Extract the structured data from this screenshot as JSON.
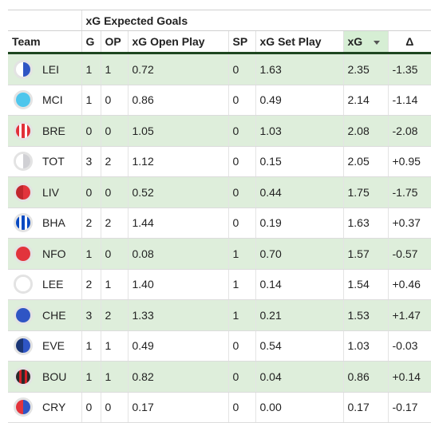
{
  "header": {
    "group_label": "xG Expected Goals",
    "columns": [
      "Team",
      "G",
      "OP",
      "xG Open Play",
      "SP",
      "xG Set Play",
      "xG",
      "Δ"
    ],
    "sorted_column": "xG"
  },
  "rows": [
    {
      "team": "LEI",
      "g": "1",
      "op": "1",
      "xg_op": "0.72",
      "sp": "0",
      "xg_sp": "1.63",
      "xg": "2.35",
      "delta": "-1.35",
      "colors": [
        "#ffffff",
        "#2f55c4"
      ]
    },
    {
      "team": "MCI",
      "g": "1",
      "op": "0",
      "xg_op": "0.86",
      "sp": "0",
      "xg_sp": "0.49",
      "xg": "2.14",
      "delta": "-1.14",
      "colors": [
        "#4ec6ec"
      ]
    },
    {
      "team": "BRE",
      "g": "0",
      "op": "0",
      "xg_op": "1.05",
      "sp": "0",
      "xg_sp": "1.03",
      "xg": "2.08",
      "delta": "-2.08",
      "colors": [
        "#e2303a",
        "#ffffff",
        "#e2303a",
        "#ffffff",
        "#e2303a"
      ]
    },
    {
      "team": "TOT",
      "g": "3",
      "op": "2",
      "xg_op": "1.12",
      "sp": "0",
      "xg_sp": "0.15",
      "xg": "2.05",
      "delta": "+0.95",
      "colors": [
        "#ffffff",
        "#d0d0d4"
      ]
    },
    {
      "team": "LIV",
      "g": "0",
      "op": "0",
      "xg_op": "0.52",
      "sp": "0",
      "xg_sp": "0.44",
      "xg": "1.75",
      "delta": "-1.75",
      "colors": [
        "#c1272d",
        "#e2343c"
      ]
    },
    {
      "team": "BHA",
      "g": "2",
      "op": "2",
      "xg_op": "1.44",
      "sp": "0",
      "xg_sp": "0.19",
      "xg": "1.63",
      "delta": "+0.37",
      "colors": [
        "#0a4ac2",
        "#ffffff",
        "#0a4ac2",
        "#ffffff",
        "#0a4ac2"
      ]
    },
    {
      "team": "NFO",
      "g": "1",
      "op": "0",
      "xg_op": "0.08",
      "sp": "1",
      "xg_sp": "0.70",
      "xg": "1.57",
      "delta": "-0.57",
      "colors": [
        "#e2343c"
      ]
    },
    {
      "team": "LEE",
      "g": "2",
      "op": "1",
      "xg_op": "1.40",
      "sp": "1",
      "xg_sp": "0.14",
      "xg": "1.54",
      "delta": "+0.46",
      "colors": [
        "#ffffff"
      ]
    },
    {
      "team": "CHE",
      "g": "3",
      "op": "2",
      "xg_op": "1.33",
      "sp": "1",
      "xg_sp": "0.21",
      "xg": "1.53",
      "delta": "+1.47",
      "colors": [
        "#2f55c4"
      ]
    },
    {
      "team": "EVE",
      "g": "1",
      "op": "1",
      "xg_op": "0.49",
      "sp": "0",
      "xg_sp": "0.54",
      "xg": "1.03",
      "delta": "-0.03",
      "colors": [
        "#1b3675",
        "#2f55c4"
      ]
    },
    {
      "team": "BOU",
      "g": "1",
      "op": "1",
      "xg_op": "0.82",
      "sp": "0",
      "xg_sp": "0.04",
      "xg": "0.86",
      "delta": "+0.14",
      "colors": [
        "#2a2a2a",
        "#d21f26",
        "#2a2a2a",
        "#d21f26",
        "#2a2a2a"
      ]
    },
    {
      "team": "CRY",
      "g": "0",
      "op": "0",
      "xg_op": "0.17",
      "sp": "0",
      "xg_sp": "0.00",
      "xg": "0.17",
      "delta": "-0.17",
      "colors": [
        "#e2343c",
        "#2f55c4"
      ]
    }
  ]
}
